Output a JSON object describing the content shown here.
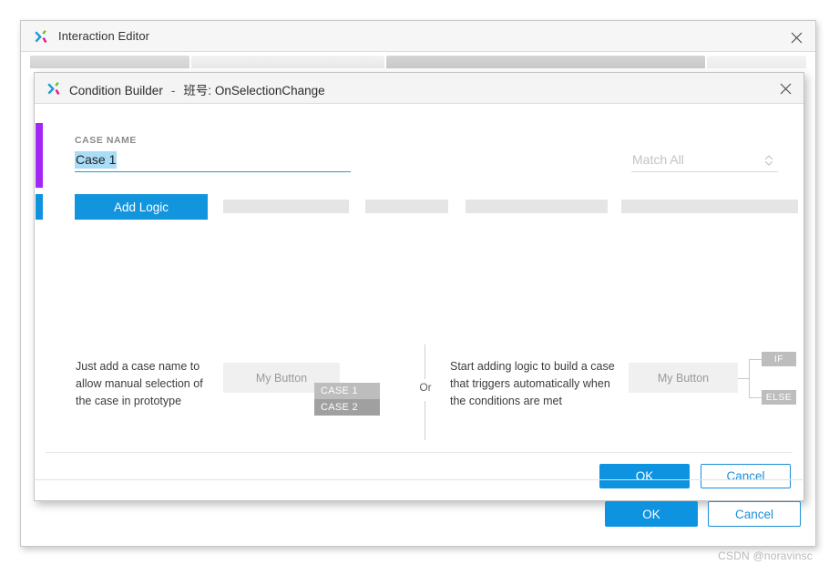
{
  "outer_window": {
    "title": "Interaction Editor",
    "logo_icon": "axure-x-logo-icon",
    "close_icon": "close-icon",
    "footer": {
      "ok_label": "OK",
      "cancel_label": "Cancel"
    }
  },
  "inner_window": {
    "logo_icon": "axure-x-logo-icon",
    "title": "Condition Builder",
    "title_dash": "-",
    "title_subject": "班号: OnSelectionChange",
    "close_icon": "close-icon",
    "case_name": {
      "label": "CASE NAME",
      "value": "Case 1",
      "placeholder": "Case 1"
    },
    "match": {
      "value": "Match All",
      "stepper_icon": "chevron-up-down-icon"
    },
    "add_logic_label": "Add Logic",
    "explainer": {
      "left_text": "Just add a case name to allow manual selection of the case in prototype",
      "left_button_label": "My Button",
      "left_case_options": [
        "CASE 1",
        "CASE 2"
      ],
      "or_label": "Or",
      "right_text": "Start adding logic to build a case that triggers automatically when the conditions are met",
      "right_button_label": "My Button",
      "right_branch_tags": [
        "IF",
        "ELSE"
      ]
    },
    "footer": {
      "ok_label": "OK",
      "cancel_label": "Cancel"
    }
  },
  "watermark": "CSDN @noravinsc",
  "colors": {
    "accent_blue": "#0d93e0",
    "accent_purple": "#a326f5",
    "input_underline": "#1a9fd4",
    "selection_highlight": "#aadcf7"
  }
}
